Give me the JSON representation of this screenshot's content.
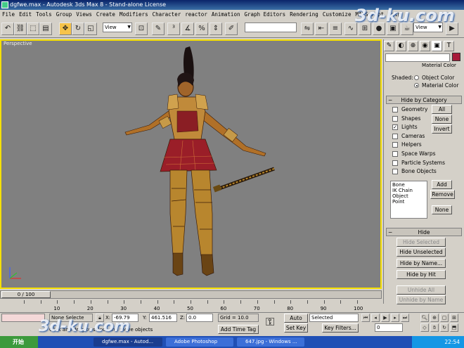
{
  "window": {
    "title": "dgfwe.max  - Autodesk 3ds Max 8  - Stand-alone License"
  },
  "menu": [
    "File",
    "Edit",
    "Tools",
    "Group",
    "Views",
    "Create",
    "Modifiers",
    "Character",
    "reactor",
    "Animation",
    "Graph Editors",
    "Rendering",
    "Customize",
    "MAXScript",
    "Help"
  ],
  "toolbar": {
    "view_select": "View",
    "view_select_right": "View"
  },
  "viewport": {
    "label": "Perspective"
  },
  "command_panel": {
    "material_color_top": "Material Color",
    "shaded_label": "Shaded:",
    "object_color": "Object Color",
    "material_color": "Material Color",
    "hide_by_category": {
      "title": "Hide by Category",
      "items": [
        {
          "label": "Geometry",
          "checked": false
        },
        {
          "label": "Shapes",
          "checked": false
        },
        {
          "label": "Lights",
          "checked": true
        },
        {
          "label": "Cameras",
          "checked": false
        },
        {
          "label": "Helpers",
          "checked": false
        },
        {
          "label": "Space Warps",
          "checked": false
        },
        {
          "label": "Particle Systems",
          "checked": false
        },
        {
          "label": "Bone Objects",
          "checked": false
        }
      ],
      "all_button": "All",
      "none_button": "None",
      "invert_button": "Invert",
      "list": [
        "Bone",
        "IK Chain Object",
        "Point"
      ],
      "add_button": "Add",
      "remove_button": "Remove",
      "none2_button": "None"
    },
    "hide": {
      "title": "Hide",
      "hide_selected": "Hide Selected",
      "hide_unselected": "Hide Unselected",
      "hide_by_name": "Hide by Name...",
      "hide_by_hit": "Hide by Hit",
      "unhide_all": "Unhide All",
      "unhide_by_name": "Unhide by Name"
    }
  },
  "timeline": {
    "slider_label": "0 / 100",
    "ticks": [
      "10",
      "20",
      "30",
      "40",
      "50",
      "60",
      "70",
      "80",
      "90",
      "100"
    ]
  },
  "status": {
    "selection": "None Selecte",
    "x_label": "X:",
    "x_value": "-69.79",
    "y_label": "Y:",
    "y_value": "461.516",
    "z_label": "Z:",
    "z_value": "0.0",
    "grid": "Grid = 10.0",
    "auto_key": "Auto Key",
    "selected": "Selected",
    "set_key": "Set Key",
    "key_filters": "Key Filters...",
    "add_time_tag": "Add Time Tag",
    "prompt": "Click and drag to select and move objects",
    "frame": "0"
  },
  "taskbar": {
    "start": "开始",
    "tasks": [
      "dgfwe.max - Autod...",
      "Adobe Photoshop",
      "647.jpg - Windows ..."
    ],
    "time": "22:54"
  },
  "watermark": "3d-ku.com"
}
